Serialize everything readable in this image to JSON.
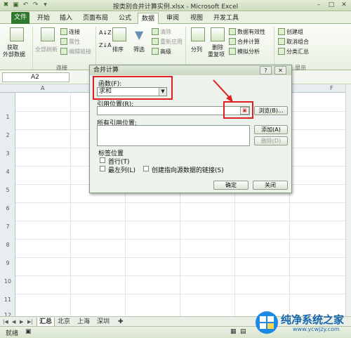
{
  "window": {
    "title": "按类别合并计算实例.xlsx - Microsoft Excel",
    "min": "–",
    "max": "□",
    "close": "✕"
  },
  "tabs": [
    "文件",
    "开始",
    "插入",
    "页面布局",
    "公式",
    "数据",
    "审阅",
    "视图",
    "开发工具"
  ],
  "active_tab": "数据",
  "ribbon": {
    "get_external": [
      "获取",
      "外部数据"
    ],
    "refresh_all": "全部刷新",
    "connections": "连接",
    "properties": "属性",
    "edit_links": "编辑链接",
    "group_connections": "连接",
    "sort": "排序",
    "filter": "筛选",
    "clear": "清除",
    "reapply": "重新应用",
    "advanced": "高级",
    "text_to_columns": "分列",
    "remove_duplicates": [
      "删除",
      "重复项"
    ],
    "data_validation": "数据有效性",
    "consolidate": "合并计算",
    "what_if": "模拟分析",
    "group": "创建组",
    "ungroup": "取消组合",
    "subtotal": "分类汇总",
    "group_outline": "显示"
  },
  "namebox": {
    "value": "A2"
  },
  "columns": [
    "A",
    "F"
  ],
  "rows": [
    "1",
    "2",
    "3",
    "4",
    "5",
    "6",
    "7",
    "8",
    "9",
    "10",
    "11",
    "12"
  ],
  "sheets": [
    "汇总",
    "北京",
    "上海",
    "深圳"
  ],
  "active_sheet": "汇总",
  "status": {
    "ready": "就绪"
  },
  "dialog": {
    "title": "合并计算",
    "help": "?",
    "close": "✕",
    "function_label": "函数(F):",
    "function_value": "求和",
    "reference_label": "引用位置(R):",
    "browse": "浏览(B)...",
    "all_references_label": "所有引用位置:",
    "add": "添加(A)",
    "delete": "删除(D)",
    "use_labels": "标签位置",
    "top_row": "首行(T)",
    "left_column": "最左列(L)",
    "link_source": "创建指向源数据的链接(S)",
    "ok": "确定",
    "close_btn": "关闭"
  },
  "watermark": {
    "brand": "纯净系统之家",
    "url": "www.ycwjzy.com"
  },
  "colors": {
    "accent": "#2f7a2f",
    "highlight": "#e02020",
    "watermark": "#1565b0"
  }
}
